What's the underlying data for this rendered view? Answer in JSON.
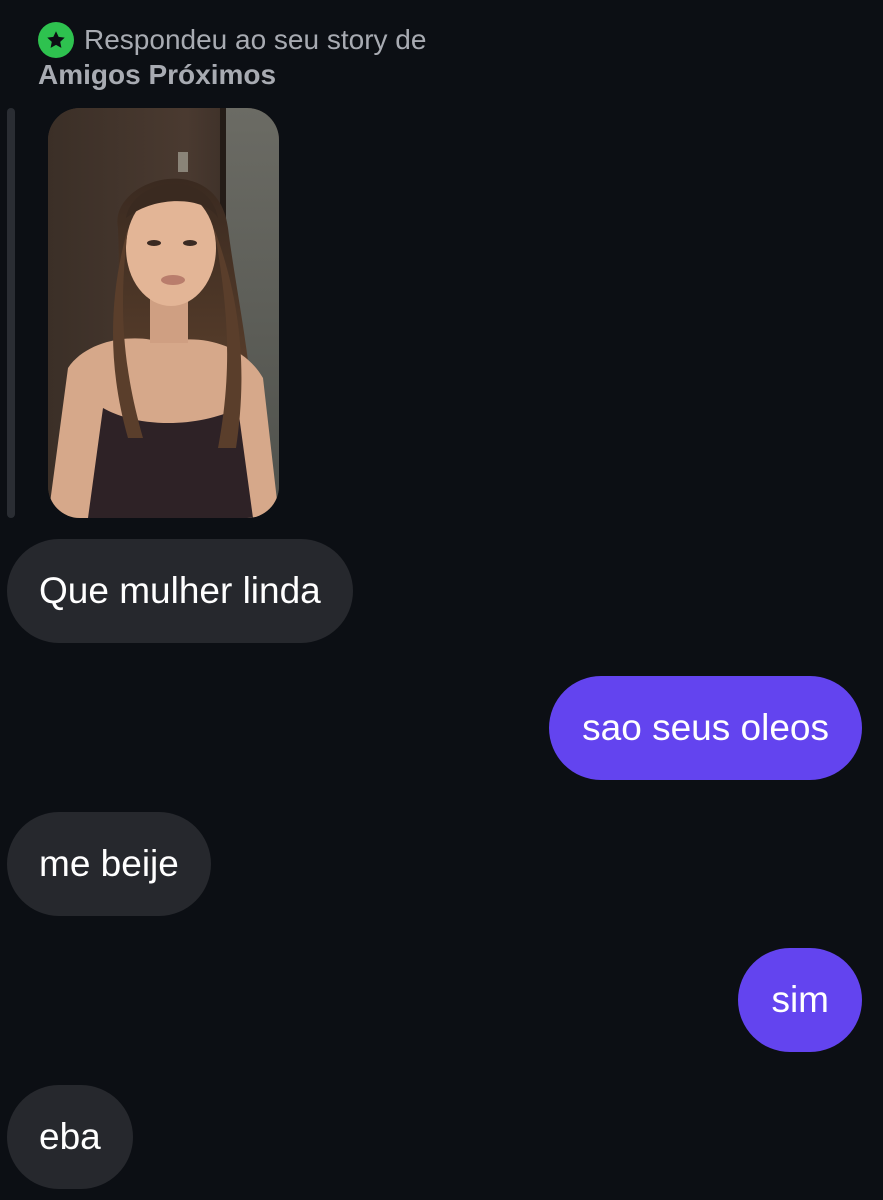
{
  "reply_header": {
    "line1": "Respondeu ao seu story de",
    "line2": "Amigos Próximos",
    "badge_icon": "star-icon",
    "badge_color": "#2ec24f"
  },
  "story": {
    "image_icon": "story-photo"
  },
  "messages": [
    {
      "direction": "received",
      "text": "Que mulher linda"
    },
    {
      "direction": "sent",
      "text": "sao seus oleos"
    },
    {
      "direction": "received",
      "text": "me beije"
    },
    {
      "direction": "sent",
      "text": "sim"
    },
    {
      "direction": "received",
      "text": "eba"
    }
  ],
  "colors": {
    "background": "#0c0f14",
    "received_bubble": "#26282d",
    "sent_bubble": "#6344ef",
    "text": "#ffffff",
    "muted_text": "#a8abb2"
  }
}
